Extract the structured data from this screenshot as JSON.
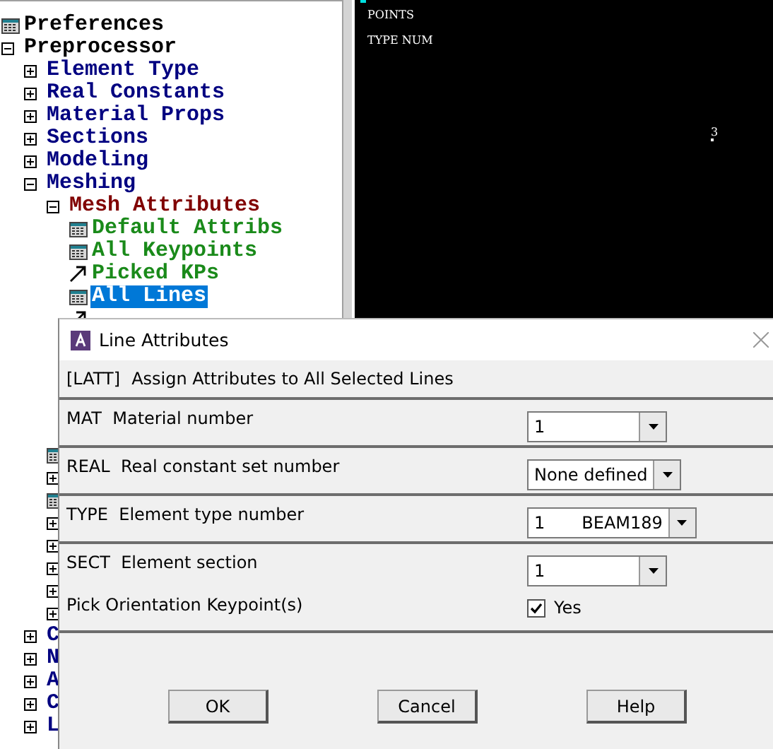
{
  "tree": [
    {
      "kind": "dialog",
      "label": "Preferences",
      "selected": false
    },
    {
      "kind": "folder",
      "label": "Preprocessor",
      "expanded": true,
      "selected": false,
      "children": [
        {
          "kind": "folder",
          "label": "Element Type",
          "expanded": false,
          "selected": false
        },
        {
          "kind": "folder",
          "label": "Real Constants",
          "expanded": false,
          "selected": false
        },
        {
          "kind": "folder",
          "label": "Material Props",
          "expanded": false,
          "selected": false
        },
        {
          "kind": "folder",
          "label": "Sections",
          "expanded": false,
          "selected": false
        },
        {
          "kind": "folder",
          "label": "Modeling",
          "expanded": false,
          "selected": false
        },
        {
          "kind": "folder",
          "label": "Meshing",
          "expanded": true,
          "selected": false,
          "children": [
            {
              "kind": "folder",
              "label": "Mesh Attributes",
              "expanded": true,
              "selected": false,
              "children": [
                {
                  "kind": "dialog",
                  "label": "Default Attribs",
                  "selected": false
                },
                {
                  "kind": "dialog",
                  "label": "All Keypoints",
                  "selected": false
                },
                {
                  "kind": "pick",
                  "label": "Picked KPs",
                  "selected": false
                },
                {
                  "kind": "dialog",
                  "label": "All Lines",
                  "selected": true
                },
                {
                  "kind": "pick"
                }
              ]
            },
            {
              "kind": "dialog"
            },
            {
              "kind": "folder",
              "expanded": false
            },
            {
              "kind": "dialog"
            },
            {
              "kind": "folder",
              "expanded": false
            },
            {
              "kind": "folder",
              "expanded": false
            },
            {
              "kind": "folder",
              "expanded": false
            },
            {
              "kind": "folder",
              "expanded": false
            },
            {
              "kind": "folder",
              "expanded": false
            }
          ]
        },
        {
          "kind": "folder",
          "label": "C",
          "expanded": false,
          "selected": false
        },
        {
          "kind": "folder",
          "label": "N",
          "expanded": false,
          "selected": false
        },
        {
          "kind": "folder",
          "label": "A",
          "expanded": false,
          "selected": false
        },
        {
          "kind": "folder",
          "label": "C",
          "expanded": false,
          "selected": false
        },
        {
          "kind": "folder",
          "label": "L",
          "expanded": false,
          "selected": false
        }
      ]
    }
  ],
  "graphics": {
    "labels": [
      "POINTS",
      "TYPE NUM"
    ],
    "point_label": "3"
  },
  "dialog": {
    "title": "Line Attributes",
    "command": "[LATT]",
    "description": "Assign Attributes to All Selected Lines",
    "sections": [
      [
        {
          "kind": "dropdown",
          "code": "MAT",
          "label": "Material number",
          "value": "1"
        }
      ],
      [
        {
          "kind": "dropdown",
          "code": "REAL",
          "label": "Real constant set number",
          "value": "None defined"
        }
      ],
      [
        {
          "kind": "dropdown",
          "code": "TYPE",
          "label": "Element type number",
          "value": "1",
          "detail": "BEAM189"
        }
      ],
      [
        {
          "kind": "dropdown",
          "code": "SECT",
          "label": "Element section",
          "value": "1"
        },
        {
          "kind": "checkbox",
          "label": "Pick Orientation Keypoint(s)",
          "option": "Yes",
          "checked": true
        }
      ]
    ],
    "buttons": [
      "OK",
      "Cancel",
      "Help"
    ]
  }
}
